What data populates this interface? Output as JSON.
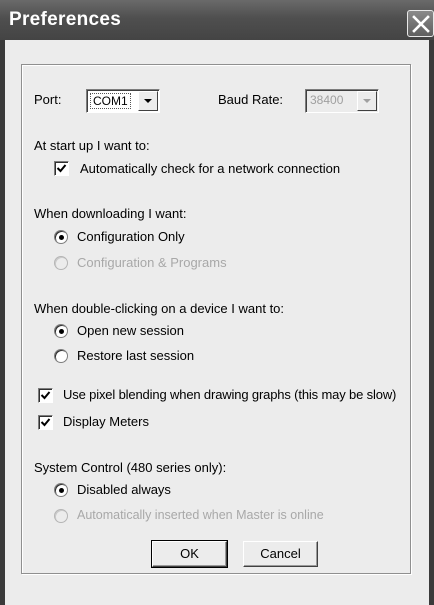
{
  "window": {
    "title": "Preferences"
  },
  "port": {
    "label": "Port:",
    "value": "COM1"
  },
  "baud": {
    "label": "Baud Rate:",
    "value": "38400",
    "enabled": false
  },
  "startup": {
    "heading": "At start up I want to:",
    "auto_check_label": "Automatically check for a network connection",
    "auto_check_checked": true
  },
  "download": {
    "heading": "When downloading I want:",
    "options": [
      {
        "label": "Configuration Only",
        "selected": true,
        "enabled": true
      },
      {
        "label": "Configuration & Programs",
        "selected": false,
        "enabled": false
      }
    ]
  },
  "double_click": {
    "heading": "When double-clicking on a device I want to:",
    "options": [
      {
        "label": "Open new session",
        "selected": true,
        "enabled": true
      },
      {
        "label": "Restore last session",
        "selected": false,
        "enabled": true
      }
    ]
  },
  "pixel_blending": {
    "label": "Use pixel blending when drawing graphs (this may be slow)",
    "checked": true
  },
  "display_meters": {
    "label": "Display Meters",
    "checked": true
  },
  "system_control": {
    "heading": "System Control (480 series only):",
    "options": [
      {
        "label": "Disabled always",
        "selected": true,
        "enabled": true
      },
      {
        "label": "Automatically inserted when Master is online",
        "selected": false,
        "enabled": false
      }
    ]
  },
  "buttons": {
    "ok": "OK",
    "cancel": "Cancel"
  },
  "icons": {
    "close": "close-icon",
    "dropdown": "chevron-down-icon",
    "check": "checkmark-icon"
  }
}
